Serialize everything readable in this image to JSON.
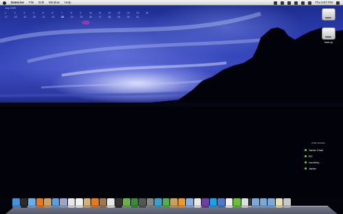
{
  "menubar": {
    "app_name": "DateLine",
    "menus": [
      "File",
      "Edit",
      "Window",
      "Help"
    ],
    "clock": "Thu 6:57 PM"
  },
  "calendar": {
    "month_label": "July 2009",
    "week1": [
      "1",
      "2",
      "3",
      "4",
      "5",
      "6",
      "7",
      "8",
      "9",
      "10",
      "11",
      "12",
      "13",
      "14",
      "15",
      "16",
      "17",
      "18",
      "19",
      "20",
      "21",
      "22",
      "23",
      "24",
      "25",
      "26",
      "27",
      "28",
      "29",
      "30",
      "31"
    ],
    "today_index": 22
  },
  "desktop_icons": [
    {
      "label": "",
      "type": "hard-drive"
    },
    {
      "label": "back.up",
      "type": "external-drive"
    }
  ],
  "buddy_list": {
    "title": "iChat Contacts",
    "buddies": [
      "Jamie Chan",
      "RC",
      "courtney",
      "Jamie"
    ]
  },
  "dock": {
    "items": [
      {
        "name": "finder",
        "color": "#4a8fd8"
      },
      {
        "name": "dashboard",
        "color": "#2b2b2b"
      },
      {
        "name": "safari",
        "color": "#6aaee8"
      },
      {
        "name": "firefox",
        "color": "#e07a2a"
      },
      {
        "name": "photo",
        "color": "#c8a06a"
      },
      {
        "name": "itunes",
        "color": "#5aa0e0"
      },
      {
        "name": "preview",
        "color": "#9aa7c8"
      },
      {
        "name": "textedit",
        "color": "#e8e8e8"
      },
      {
        "name": "ical",
        "color": "#f2f2f2"
      },
      {
        "name": "scripts",
        "color": "#d4b07a"
      },
      {
        "name": "vlc",
        "color": "#e87a1a"
      },
      {
        "name": "address-book",
        "color": "#a07850"
      },
      {
        "name": "font-book",
        "color": "#e8e8e8"
      },
      {
        "name": "terminal",
        "color": "#333333"
      },
      {
        "name": "pages",
        "color": "#6ab04a"
      },
      {
        "name": "time-machine",
        "color": "#3a8a3a"
      },
      {
        "name": "photo-booth",
        "color": "#555555"
      },
      {
        "name": "camera",
        "color": "#888888"
      },
      {
        "name": "coda",
        "color": "#3aa0c8"
      },
      {
        "name": "growl",
        "color": "#50b050"
      },
      {
        "name": "cyberduck",
        "color": "#c8a060"
      },
      {
        "name": "transmit",
        "color": "#e89a30"
      },
      {
        "name": "upload",
        "color": "#8ab0e0"
      },
      {
        "name": "chat-bubble",
        "color": "#e8e8e8"
      },
      {
        "name": "ichat",
        "color": "#7040a0"
      },
      {
        "name": "skype",
        "color": "#1aa3e0"
      },
      {
        "name": "xcode",
        "color": "#4a7ac8"
      },
      {
        "name": "network",
        "color": "#f0f0f0"
      },
      {
        "name": "tools",
        "color": "#6abf40"
      },
      {
        "name": "paper",
        "color": "#e0e0e0"
      },
      {
        "name": "downloads-folder",
        "color": "#7aa8d8"
      },
      {
        "name": "documents-folder",
        "color": "#7aa8d8"
      },
      {
        "name": "applications-folder",
        "color": "#7aa8d8"
      },
      {
        "name": "notes",
        "color": "#e8e0b0"
      },
      {
        "name": "trash",
        "color": "#c8c8c8"
      }
    ]
  }
}
